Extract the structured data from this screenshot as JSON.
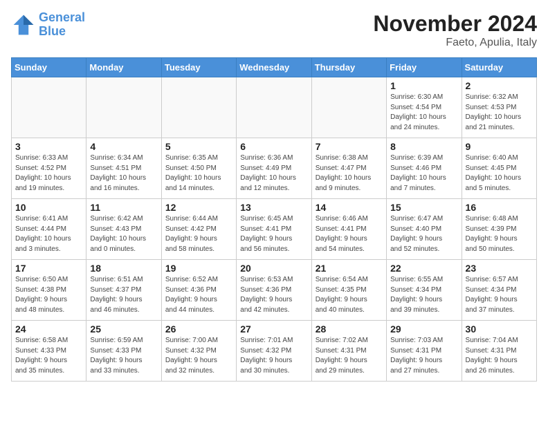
{
  "logo": {
    "line1": "General",
    "line2": "Blue"
  },
  "title": "November 2024",
  "location": "Faeto, Apulia, Italy",
  "weekdays": [
    "Sunday",
    "Monday",
    "Tuesday",
    "Wednesday",
    "Thursday",
    "Friday",
    "Saturday"
  ],
  "weeks": [
    [
      {
        "day": "",
        "info": ""
      },
      {
        "day": "",
        "info": ""
      },
      {
        "day": "",
        "info": ""
      },
      {
        "day": "",
        "info": ""
      },
      {
        "day": "",
        "info": ""
      },
      {
        "day": "1",
        "info": "Sunrise: 6:30 AM\nSunset: 4:54 PM\nDaylight: 10 hours\nand 24 minutes."
      },
      {
        "day": "2",
        "info": "Sunrise: 6:32 AM\nSunset: 4:53 PM\nDaylight: 10 hours\nand 21 minutes."
      }
    ],
    [
      {
        "day": "3",
        "info": "Sunrise: 6:33 AM\nSunset: 4:52 PM\nDaylight: 10 hours\nand 19 minutes."
      },
      {
        "day": "4",
        "info": "Sunrise: 6:34 AM\nSunset: 4:51 PM\nDaylight: 10 hours\nand 16 minutes."
      },
      {
        "day": "5",
        "info": "Sunrise: 6:35 AM\nSunset: 4:50 PM\nDaylight: 10 hours\nand 14 minutes."
      },
      {
        "day": "6",
        "info": "Sunrise: 6:36 AM\nSunset: 4:49 PM\nDaylight: 10 hours\nand 12 minutes."
      },
      {
        "day": "7",
        "info": "Sunrise: 6:38 AM\nSunset: 4:47 PM\nDaylight: 10 hours\nand 9 minutes."
      },
      {
        "day": "8",
        "info": "Sunrise: 6:39 AM\nSunset: 4:46 PM\nDaylight: 10 hours\nand 7 minutes."
      },
      {
        "day": "9",
        "info": "Sunrise: 6:40 AM\nSunset: 4:45 PM\nDaylight: 10 hours\nand 5 minutes."
      }
    ],
    [
      {
        "day": "10",
        "info": "Sunrise: 6:41 AM\nSunset: 4:44 PM\nDaylight: 10 hours\nand 3 minutes."
      },
      {
        "day": "11",
        "info": "Sunrise: 6:42 AM\nSunset: 4:43 PM\nDaylight: 10 hours\nand 0 minutes."
      },
      {
        "day": "12",
        "info": "Sunrise: 6:44 AM\nSunset: 4:42 PM\nDaylight: 9 hours\nand 58 minutes."
      },
      {
        "day": "13",
        "info": "Sunrise: 6:45 AM\nSunset: 4:41 PM\nDaylight: 9 hours\nand 56 minutes."
      },
      {
        "day": "14",
        "info": "Sunrise: 6:46 AM\nSunset: 4:41 PM\nDaylight: 9 hours\nand 54 minutes."
      },
      {
        "day": "15",
        "info": "Sunrise: 6:47 AM\nSunset: 4:40 PM\nDaylight: 9 hours\nand 52 minutes."
      },
      {
        "day": "16",
        "info": "Sunrise: 6:48 AM\nSunset: 4:39 PM\nDaylight: 9 hours\nand 50 minutes."
      }
    ],
    [
      {
        "day": "17",
        "info": "Sunrise: 6:50 AM\nSunset: 4:38 PM\nDaylight: 9 hours\nand 48 minutes."
      },
      {
        "day": "18",
        "info": "Sunrise: 6:51 AM\nSunset: 4:37 PM\nDaylight: 9 hours\nand 46 minutes."
      },
      {
        "day": "19",
        "info": "Sunrise: 6:52 AM\nSunset: 4:36 PM\nDaylight: 9 hours\nand 44 minutes."
      },
      {
        "day": "20",
        "info": "Sunrise: 6:53 AM\nSunset: 4:36 PM\nDaylight: 9 hours\nand 42 minutes."
      },
      {
        "day": "21",
        "info": "Sunrise: 6:54 AM\nSunset: 4:35 PM\nDaylight: 9 hours\nand 40 minutes."
      },
      {
        "day": "22",
        "info": "Sunrise: 6:55 AM\nSunset: 4:34 PM\nDaylight: 9 hours\nand 39 minutes."
      },
      {
        "day": "23",
        "info": "Sunrise: 6:57 AM\nSunset: 4:34 PM\nDaylight: 9 hours\nand 37 minutes."
      }
    ],
    [
      {
        "day": "24",
        "info": "Sunrise: 6:58 AM\nSunset: 4:33 PM\nDaylight: 9 hours\nand 35 minutes."
      },
      {
        "day": "25",
        "info": "Sunrise: 6:59 AM\nSunset: 4:33 PM\nDaylight: 9 hours\nand 33 minutes."
      },
      {
        "day": "26",
        "info": "Sunrise: 7:00 AM\nSunset: 4:32 PM\nDaylight: 9 hours\nand 32 minutes."
      },
      {
        "day": "27",
        "info": "Sunrise: 7:01 AM\nSunset: 4:32 PM\nDaylight: 9 hours\nand 30 minutes."
      },
      {
        "day": "28",
        "info": "Sunrise: 7:02 AM\nSunset: 4:31 PM\nDaylight: 9 hours\nand 29 minutes."
      },
      {
        "day": "29",
        "info": "Sunrise: 7:03 AM\nSunset: 4:31 PM\nDaylight: 9 hours\nand 27 minutes."
      },
      {
        "day": "30",
        "info": "Sunrise: 7:04 AM\nSunset: 4:31 PM\nDaylight: 9 hours\nand 26 minutes."
      }
    ]
  ]
}
